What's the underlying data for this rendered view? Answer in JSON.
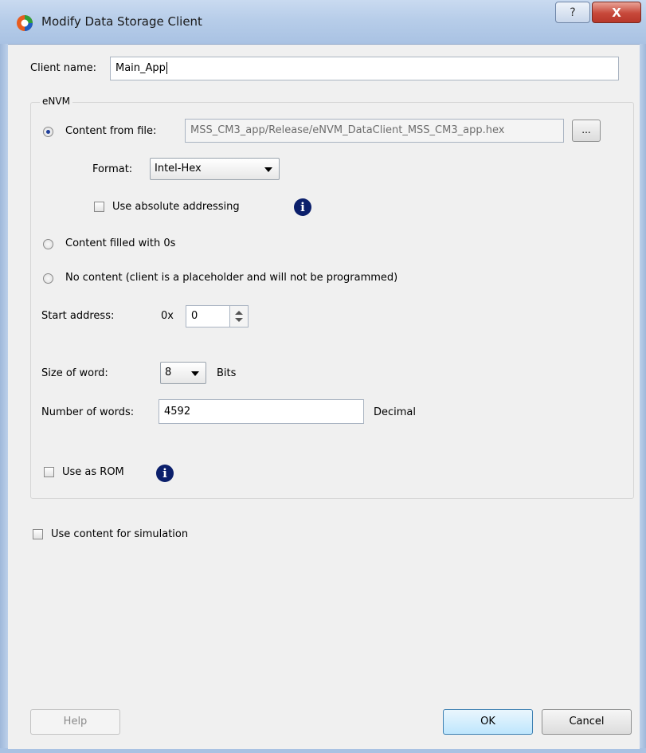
{
  "window": {
    "title": "Modify Data Storage Client",
    "help_glyph": "?",
    "close_glyph": "X",
    "icon": "app-icon"
  },
  "client_name": {
    "label": "Client name:",
    "value": "Main_App"
  },
  "envm": {
    "group_title": "eNVM",
    "content_from_file": {
      "label": "Content from file:",
      "selected": true,
      "path": "MSS_CM3_app/Release/eNVM_DataClient_MSS_CM3_app.hex",
      "browse_label": "..."
    },
    "format": {
      "label": "Format:",
      "value": "Intel-Hex"
    },
    "absolute_addressing": {
      "label": "Use absolute addressing",
      "checked": false
    },
    "content_filled_zeros": {
      "label": "Content filled with 0s",
      "selected": false
    },
    "no_content": {
      "label": "No content (client is a placeholder and will not be programmed)",
      "selected": false
    },
    "start_address": {
      "label": "Start address:",
      "prefix": "0x",
      "value": "0"
    },
    "size_of_word": {
      "label": "Size of word:",
      "value": "8",
      "unit": "Bits"
    },
    "number_of_words": {
      "label": "Number of words:",
      "value": "4592",
      "unit": "Decimal"
    },
    "use_as_rom": {
      "label": "Use as ROM",
      "checked": false
    },
    "info_glyph": "i"
  },
  "use_content_for_simulation": {
    "label": "Use content for simulation",
    "checked": false
  },
  "buttons": {
    "help": "Help",
    "ok": "OK",
    "cancel": "Cancel"
  },
  "colors": {
    "accent": "#0b1f6b",
    "title_bar": "#b7cde9",
    "close": "#c7483a"
  }
}
